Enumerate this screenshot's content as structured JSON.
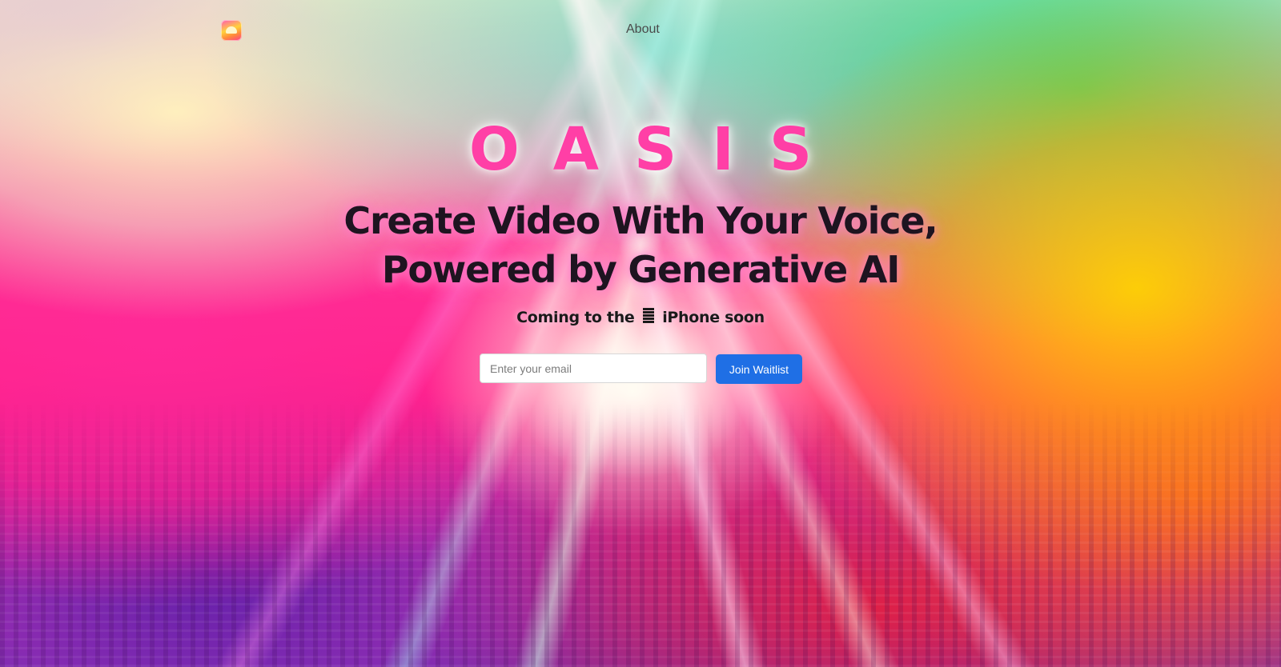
{
  "nav": {
    "logo_icon": "sunrise-app-icon",
    "about_label": "About"
  },
  "hero": {
    "brand": "OASIS",
    "headline_line1": "Create Video With Your Voice,",
    "headline_line2": "Powered by Generative AI",
    "subline_before": "Coming to the",
    "subline_icon": "apple-icon",
    "subline_after": "iPhone soon"
  },
  "waitlist": {
    "email_placeholder": "Enter your email",
    "email_value": "",
    "button_label": "Join Waitlist"
  },
  "colors": {
    "brand_pink": "#ff3fa6",
    "button_blue": "#1f6fe5",
    "headline_text": "#1e1420"
  }
}
